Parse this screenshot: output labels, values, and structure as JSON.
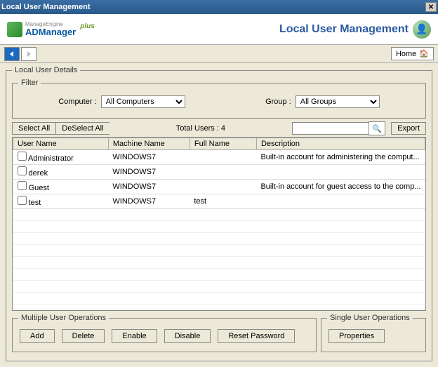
{
  "titlebar": {
    "title": "Local User Management"
  },
  "logo": {
    "line1": "ManageEngine",
    "line2": "ADManager",
    "plus": "plus"
  },
  "header": {
    "title": "Local User Management"
  },
  "nav": {
    "home": "Home"
  },
  "details_legend": "Local User Details",
  "filter": {
    "legend": "Filter",
    "computer_label": "Computer  :",
    "group_label": "Group  :",
    "computer_selected": "All Computers",
    "group_selected": "All Groups"
  },
  "toolbar": {
    "select_all": "Select All",
    "deselect_all": "DeSelect All",
    "total_users": "Total Users : 4",
    "export": "Export",
    "search_placeholder": ""
  },
  "table": {
    "headers": {
      "user": "User Name",
      "machine": "Machine Name",
      "full": "Full Name",
      "desc": "Description"
    },
    "rows": [
      {
        "user": "Administrator",
        "machine": "WINDOWS7",
        "full": "",
        "desc": "Built-in account for administering the comput..."
      },
      {
        "user": "derek",
        "machine": "WINDOWS7",
        "full": "",
        "desc": ""
      },
      {
        "user": "Guest",
        "machine": "WINDOWS7",
        "full": "",
        "desc": "Built-in account for guest access to the comp..."
      },
      {
        "user": "test",
        "machine": "WINDOWS7",
        "full": "test",
        "desc": ""
      }
    ]
  },
  "multi_ops": {
    "legend": "Multiple User Operations",
    "add": "Add",
    "delete": "Delete",
    "enable": "Enable",
    "disable": "Disable",
    "reset": "Reset Password"
  },
  "single_ops": {
    "legend": "Single User Operations",
    "properties": "Properties"
  }
}
